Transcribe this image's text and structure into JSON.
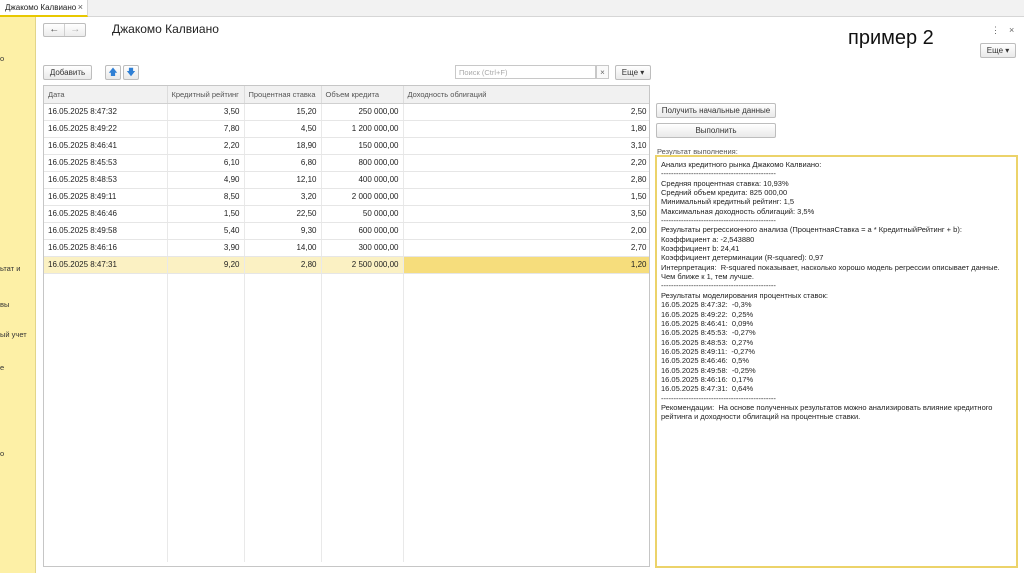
{
  "tab": {
    "title": "Джакомо Калвиано",
    "close": "×"
  },
  "sidebar": {
    "items": [
      "о",
      "ьтат и",
      "вы",
      "ый учет",
      "е",
      "о"
    ]
  },
  "header": {
    "title": "Джакомо Калвиано",
    "back": "←",
    "forward": "→",
    "sample_label": "пример 2",
    "menu_icon": "⋮",
    "close_icon": "×",
    "more_top": "Еще ▾"
  },
  "toolbar": {
    "add_label": "Добавить",
    "up": "🡅",
    "down": "🡇",
    "search_placeholder": "Поиск (Ctrl+F)",
    "search_clear": "×",
    "more_label": "Еще ▾"
  },
  "table": {
    "columns": [
      "Дата",
      "Кредитный рейтинг",
      "Процентная ставка",
      "Объем кредита",
      "Доходность облигаций"
    ],
    "rows": [
      [
        "16.05.2025 8:47:32",
        "3,50",
        "15,20",
        "250 000,00",
        "2,50"
      ],
      [
        "16.05.2025 8:49:22",
        "7,80",
        "4,50",
        "1 200 000,00",
        "1,80"
      ],
      [
        "16.05.2025 8:46:41",
        "2,20",
        "18,90",
        "150 000,00",
        "3,10"
      ],
      [
        "16.05.2025 8:45:53",
        "6,10",
        "6,80",
        "800 000,00",
        "2,20"
      ],
      [
        "16.05.2025 8:48:53",
        "4,90",
        "12,10",
        "400 000,00",
        "2,80"
      ],
      [
        "16.05.2025 8:49:11",
        "8,50",
        "3,20",
        "2 000 000,00",
        "1,50"
      ],
      [
        "16.05.2025 8:46:46",
        "1,50",
        "22,50",
        "50 000,00",
        "3,50"
      ],
      [
        "16.05.2025 8:49:58",
        "5,40",
        "9,30",
        "600 000,00",
        "2,00"
      ],
      [
        "16.05.2025 8:46:16",
        "3,90",
        "14,00",
        "300 000,00",
        "2,70"
      ],
      [
        "16.05.2025 8:47:31",
        "9,20",
        "2,80",
        "2 500 000,00",
        "1,20"
      ]
    ],
    "selected_row": 9
  },
  "actions": {
    "get_data_label": "Получить начальные данные",
    "execute_label": "Выполнить"
  },
  "result": {
    "label": "Результат выполнения:",
    "lines": [
      "Анализ кредитного рынка Джакомо Калвиано:",
      "----------------------------------------------",
      "Средняя процентная ставка: 10,93%",
      "Средний объем кредита: 825 000,00",
      "Минимальный кредитный рейтинг: 1,5",
      "Максимальная доходность облигаций: 3,5%",
      "----------------------------------------------",
      "Результаты регрессионного анализа (ПроцентнаяСтавка = a * КредитныйРейтинг + b):",
      "Коэффициент a: -2,543880",
      "Коэффициент b: 24,41",
      "Коэффициент детерминации (R-squared): 0,97",
      "Интерпретация:  R-squared показывает, насколько хорошо модель регрессии описывает данные.",
      "Чем ближе к 1, тем лучше.",
      "----------------------------------------------",
      "Результаты моделирования процентных ставок:",
      "16.05.2025 8:47:32:  -0,3%",
      "16.05.2025 8:49:22:  0,25%",
      "16.05.2025 8:46:41:  0,09%",
      "16.05.2025 8:45:53:  -0,27%",
      "16.05.2025 8:48:53:  0,27%",
      "16.05.2025 8:49:11:  -0,27%",
      "16.05.2025 8:46:46:  0,5%",
      "16.05.2025 8:49:58:  -0,25%",
      "16.05.2025 8:46:16:  0,17%",
      "16.05.2025 8:47:31:  0,64%",
      "----------------------------------------------",
      "Рекомендации:  На основе полученных результатов можно анализировать влияние кредитного",
      "рейтинга и доходности облигаций на процентные ставки."
    ]
  }
}
